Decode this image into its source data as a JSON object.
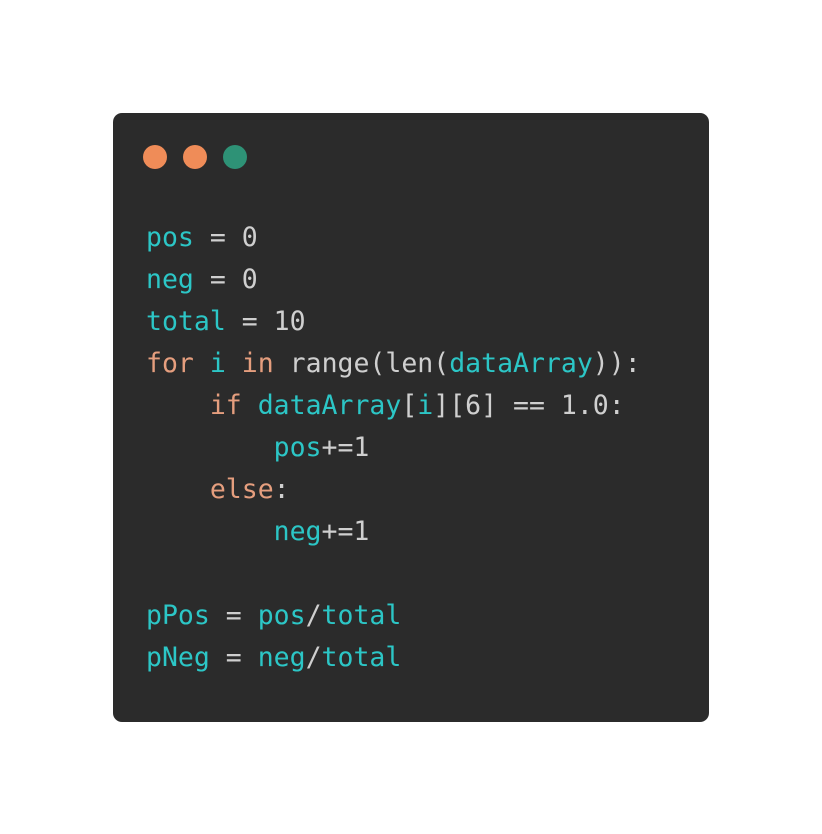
{
  "window": {
    "controls": [
      {
        "name": "close-dot",
        "color": "#ef8c58"
      },
      {
        "name": "minimize-dot",
        "color": "#ef8c58"
      },
      {
        "name": "zoom-dot",
        "color": "#2e9276"
      }
    ]
  },
  "colors": {
    "variable": "#2cc6c6",
    "keyword": "#e59e7e",
    "text": "#cfcfcf",
    "background": "#2b2b2b"
  },
  "code": {
    "lines": [
      [
        {
          "t": "pos",
          "c": "variable"
        },
        {
          "t": " = 0",
          "c": "text"
        }
      ],
      [
        {
          "t": "neg",
          "c": "variable"
        },
        {
          "t": " = 0",
          "c": "text"
        }
      ],
      [
        {
          "t": "total",
          "c": "variable"
        },
        {
          "t": " = 10",
          "c": "text"
        }
      ],
      [
        {
          "t": "for",
          "c": "keyword"
        },
        {
          "t": " ",
          "c": "text"
        },
        {
          "t": "i",
          "c": "variable"
        },
        {
          "t": " ",
          "c": "text"
        },
        {
          "t": "in",
          "c": "keyword"
        },
        {
          "t": " range(len(",
          "c": "text"
        },
        {
          "t": "dataArray",
          "c": "variable"
        },
        {
          "t": ")):",
          "c": "text"
        }
      ],
      [
        {
          "t": "    ",
          "c": "text"
        },
        {
          "t": "if",
          "c": "keyword"
        },
        {
          "t": " ",
          "c": "text"
        },
        {
          "t": "dataArray",
          "c": "variable"
        },
        {
          "t": "[",
          "c": "text"
        },
        {
          "t": "i",
          "c": "variable"
        },
        {
          "t": "][6] == 1.0:",
          "c": "text"
        }
      ],
      [
        {
          "t": "        ",
          "c": "text"
        },
        {
          "t": "pos",
          "c": "variable"
        },
        {
          "t": "+=1",
          "c": "text"
        }
      ],
      [
        {
          "t": "    ",
          "c": "text"
        },
        {
          "t": "else",
          "c": "keyword"
        },
        {
          "t": ":",
          "c": "text"
        }
      ],
      [
        {
          "t": "        ",
          "c": "text"
        },
        {
          "t": "neg",
          "c": "variable"
        },
        {
          "t": "+=1",
          "c": "text"
        }
      ],
      [],
      [
        {
          "t": "pPos",
          "c": "variable"
        },
        {
          "t": " = ",
          "c": "text"
        },
        {
          "t": "pos",
          "c": "variable"
        },
        {
          "t": "/",
          "c": "text"
        },
        {
          "t": "total",
          "c": "variable"
        }
      ],
      [
        {
          "t": "pNeg",
          "c": "variable"
        },
        {
          "t": " = ",
          "c": "text"
        },
        {
          "t": "neg",
          "c": "variable"
        },
        {
          "t": "/",
          "c": "text"
        },
        {
          "t": "total",
          "c": "variable"
        }
      ]
    ]
  }
}
